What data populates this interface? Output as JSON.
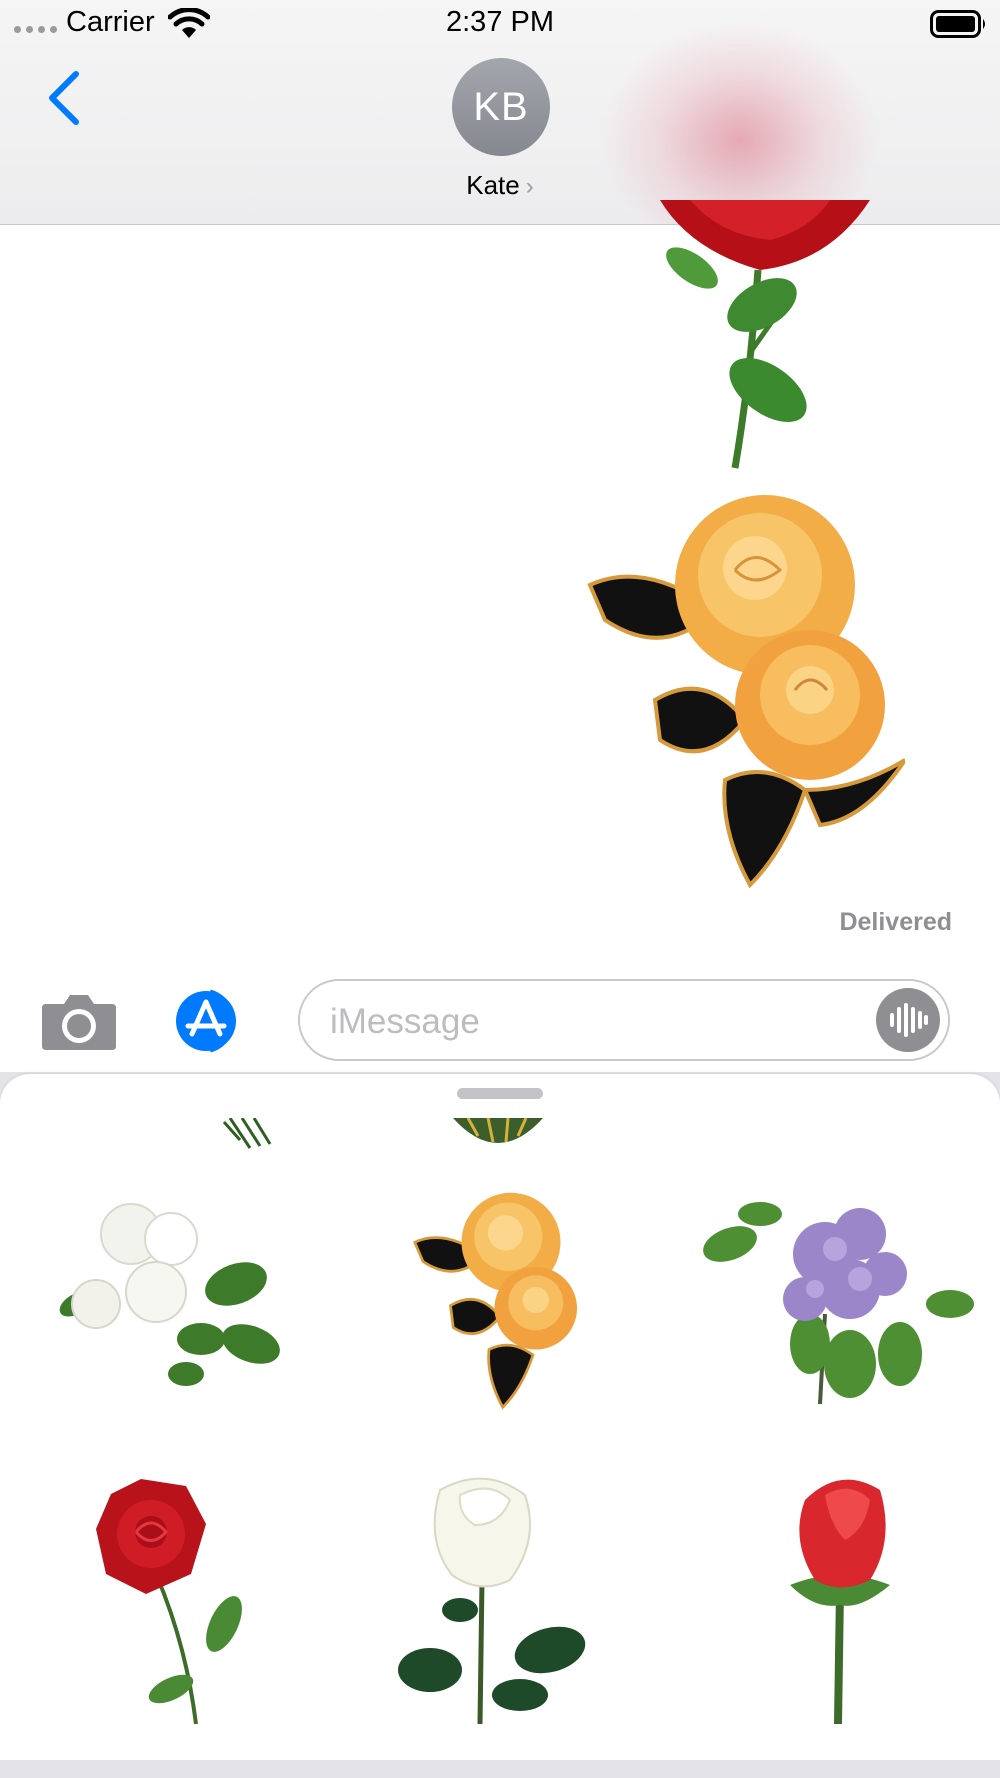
{
  "status_bar": {
    "carrier": "Carrier",
    "time": "2:37 PM"
  },
  "header": {
    "avatar_initials": "KB",
    "contact_name": "Kate",
    "contact_chevron": "›"
  },
  "conversation": {
    "stickers": [
      {
        "name": "red-rose-sticker"
      },
      {
        "name": "yellow-roses-sticker"
      }
    ],
    "delivered_label": "Delivered"
  },
  "input_bar": {
    "placeholder": "iMessage"
  },
  "drawer": {
    "stickers": [
      {
        "name": "white-roses"
      },
      {
        "name": "yellow-roses"
      },
      {
        "name": "lilac"
      },
      {
        "name": "red-rose-stem"
      },
      {
        "name": "white-rose"
      },
      {
        "name": "red-rose-bud"
      }
    ]
  },
  "colors": {
    "accent": "#007aff",
    "rose_red": "#c0141c",
    "yellow_rose": "#f6b44a"
  }
}
